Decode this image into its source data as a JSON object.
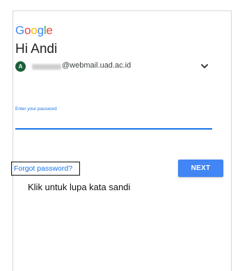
{
  "brand": {
    "logo_letters": [
      {
        "char": "G",
        "color": "#4285F4"
      },
      {
        "char": "o",
        "color": "#EA4335"
      },
      {
        "char": "o",
        "color": "#FBBC05"
      },
      {
        "char": "g",
        "color": "#4285F4"
      },
      {
        "char": "l",
        "color": "#34A853"
      },
      {
        "char": "e",
        "color": "#EA4335"
      }
    ]
  },
  "header": {
    "greeting": "Hi Andi"
  },
  "account": {
    "avatar_initial": "A",
    "email_visible": "@webmail.uad.ac.id",
    "switch_icon": "chevron-down-icon"
  },
  "password_field": {
    "label": "Enter your password",
    "value": ""
  },
  "actions": {
    "forgot_label": "Forgot password?",
    "next_label": "NEXT"
  },
  "annotation": {
    "caption": "Klik untuk lupa kata sandi"
  },
  "colors": {
    "accent": "#1a73e8",
    "button": "#4285f4",
    "avatar": "#1b5e3b"
  }
}
